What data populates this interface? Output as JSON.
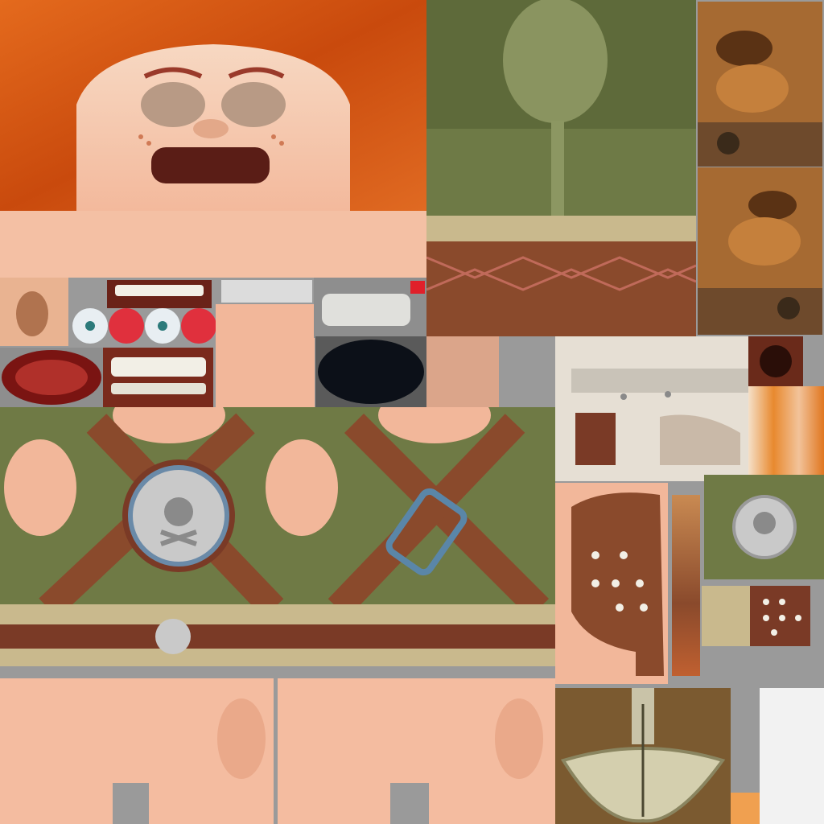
{
  "atlas": {
    "regions": [
      "face",
      "balloon-sleeve",
      "boots",
      "mouth-parts",
      "torso",
      "helmet",
      "pads",
      "legs",
      "axe"
    ]
  },
  "colors": {
    "background": "#9a9a9a",
    "skin": "#f2b79a",
    "hair": "#d9540f",
    "olive": "#6f7a45",
    "leather": "#8a4a2c",
    "metal": "#c9c9c9",
    "fur": "#c9b98d",
    "brass": "#7b5a30"
  },
  "icons": [
    "skull-crossbones-emblem-icon",
    "eyeball-icon",
    "tooth-row-icon"
  ]
}
